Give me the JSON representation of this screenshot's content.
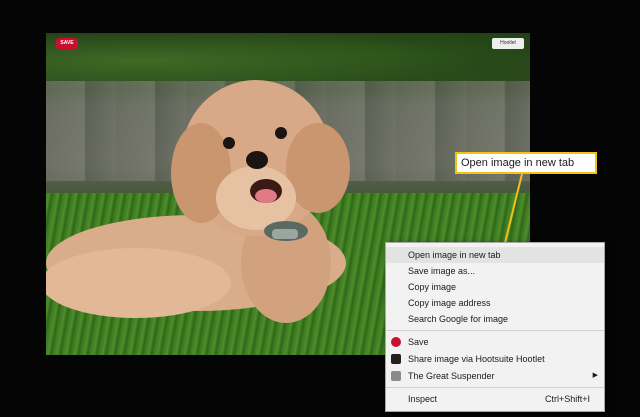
{
  "photo": {
    "pin_badge": "SAVE",
    "hoot_badge": "Hootlet"
  },
  "callout": {
    "label": "Open image in new tab"
  },
  "context_menu": {
    "items": [
      {
        "label": "Open image in new tab"
      },
      {
        "label": "Save image as..."
      },
      {
        "label": "Copy image"
      },
      {
        "label": "Copy image address"
      },
      {
        "label": "Search Google for image"
      },
      {
        "label": "Save"
      },
      {
        "label": "Share image via Hootsuite Hootlet"
      },
      {
        "label": "The Great Suspender"
      },
      {
        "label": "Inspect",
        "shortcut": "Ctrl+Shift+I"
      }
    ]
  },
  "colors": {
    "callout_border": "#f2c21b",
    "pinterest": "#c8102e"
  }
}
